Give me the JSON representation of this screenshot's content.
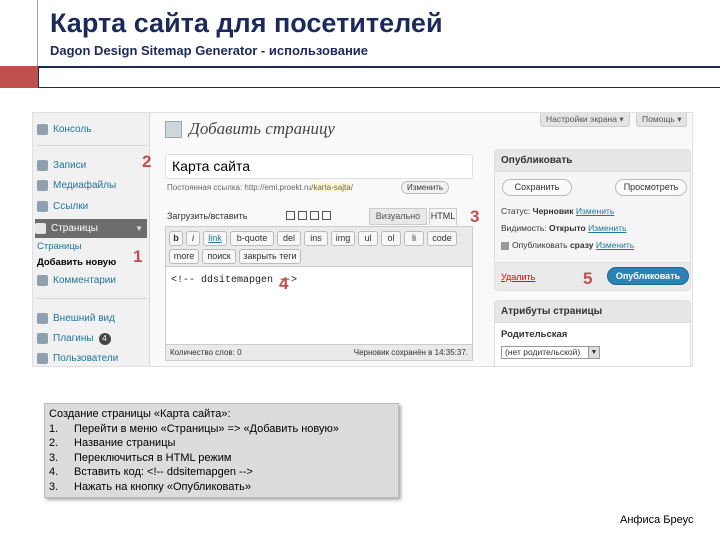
{
  "slide": {
    "title": "Карта сайта для посетителей",
    "subtitle": "Dagon Design Sitemap Generator - использование",
    "author": "Анфиса Бреус",
    "colors": {
      "accent": "#c0504d",
      "title": "#1c2a5a"
    }
  },
  "screenshot": {
    "top_buttons": [
      "Настройки экрана ▾",
      "Помощь ▾"
    ],
    "menu": {
      "items": [
        {
          "label": "Консоль",
          "icon": "dashboard-icon"
        },
        {
          "label": "Записи",
          "icon": "pin-icon"
        },
        {
          "label": "Медиафайлы",
          "icon": "media-icon"
        },
        {
          "label": "Ссылки",
          "icon": "links-icon"
        },
        {
          "label": "Страницы",
          "icon": "pages-icon"
        },
        {
          "label": "Комментарии",
          "icon": "comments-icon"
        },
        {
          "label": "Внешний вид",
          "icon": "appearance-icon"
        },
        {
          "label": "Плагины",
          "icon": "plugins-icon",
          "badge": "4"
        },
        {
          "label": "Пользователи",
          "icon": "users-icon"
        }
      ],
      "sub_items": [
        "Страницы",
        "Добавить новую"
      ]
    },
    "page_heading": "Добавить страницу",
    "title_value": "Карта сайта",
    "permalink": {
      "label": "Постоянная ссылка:",
      "url": "http://emi.proekt.ru/",
      "slug": "karta-sajta",
      "suffix": "/",
      "edit": "Изменить"
    },
    "upload_label": "Загрузить/вставить",
    "tabs": {
      "visual": "Визуально",
      "html": "HTML"
    },
    "quicktags_row1": [
      "b",
      "i",
      "link",
      "b-quote",
      "del",
      "ins",
      "img",
      "ul",
      "ol",
      "li",
      "code"
    ],
    "quicktags_row2": [
      "more",
      "поиск",
      "закрыть теги"
    ],
    "editor_content": "<!-- ddsitemapgen -->",
    "word_count": "Количество слов: 0",
    "draft_saved": "Черновик сохранён в 14:35:37.",
    "publish_box": {
      "title": "Опубликовать",
      "save": "Сохранить",
      "preview": "Просмотреть",
      "status_label": "Статус:",
      "status_value": "Черновик",
      "visibility_label": "Видимость:",
      "visibility_value": "Открыто",
      "publish_label": "Опубликовать",
      "publish_value": "сразу",
      "change": "Изменить",
      "delete": "Удалить",
      "publish_button": "Опубликовать"
    },
    "attributes_box": {
      "title": "Атрибуты страницы",
      "parent_label": "Родительская",
      "parent_value": "(нет родительской)"
    },
    "markers": [
      "1",
      "2",
      "3",
      "4",
      "5"
    ]
  },
  "instructions": {
    "title": "Создание страницы «Карта сайта»:",
    "steps": [
      {
        "n": "1.",
        "text": "Перейти в меню «Страницы» => «Добавить новую»"
      },
      {
        "n": "2.",
        "text": "Название страницы"
      },
      {
        "n": "3.",
        "text": "Переключиться в HTML режим"
      },
      {
        "n": "4.",
        "text": "Вставить код: <!-- ddsitemapgen -->"
      },
      {
        "n": "3.",
        "text": "Нажать на кнопку «Опубликовать»"
      }
    ]
  }
}
